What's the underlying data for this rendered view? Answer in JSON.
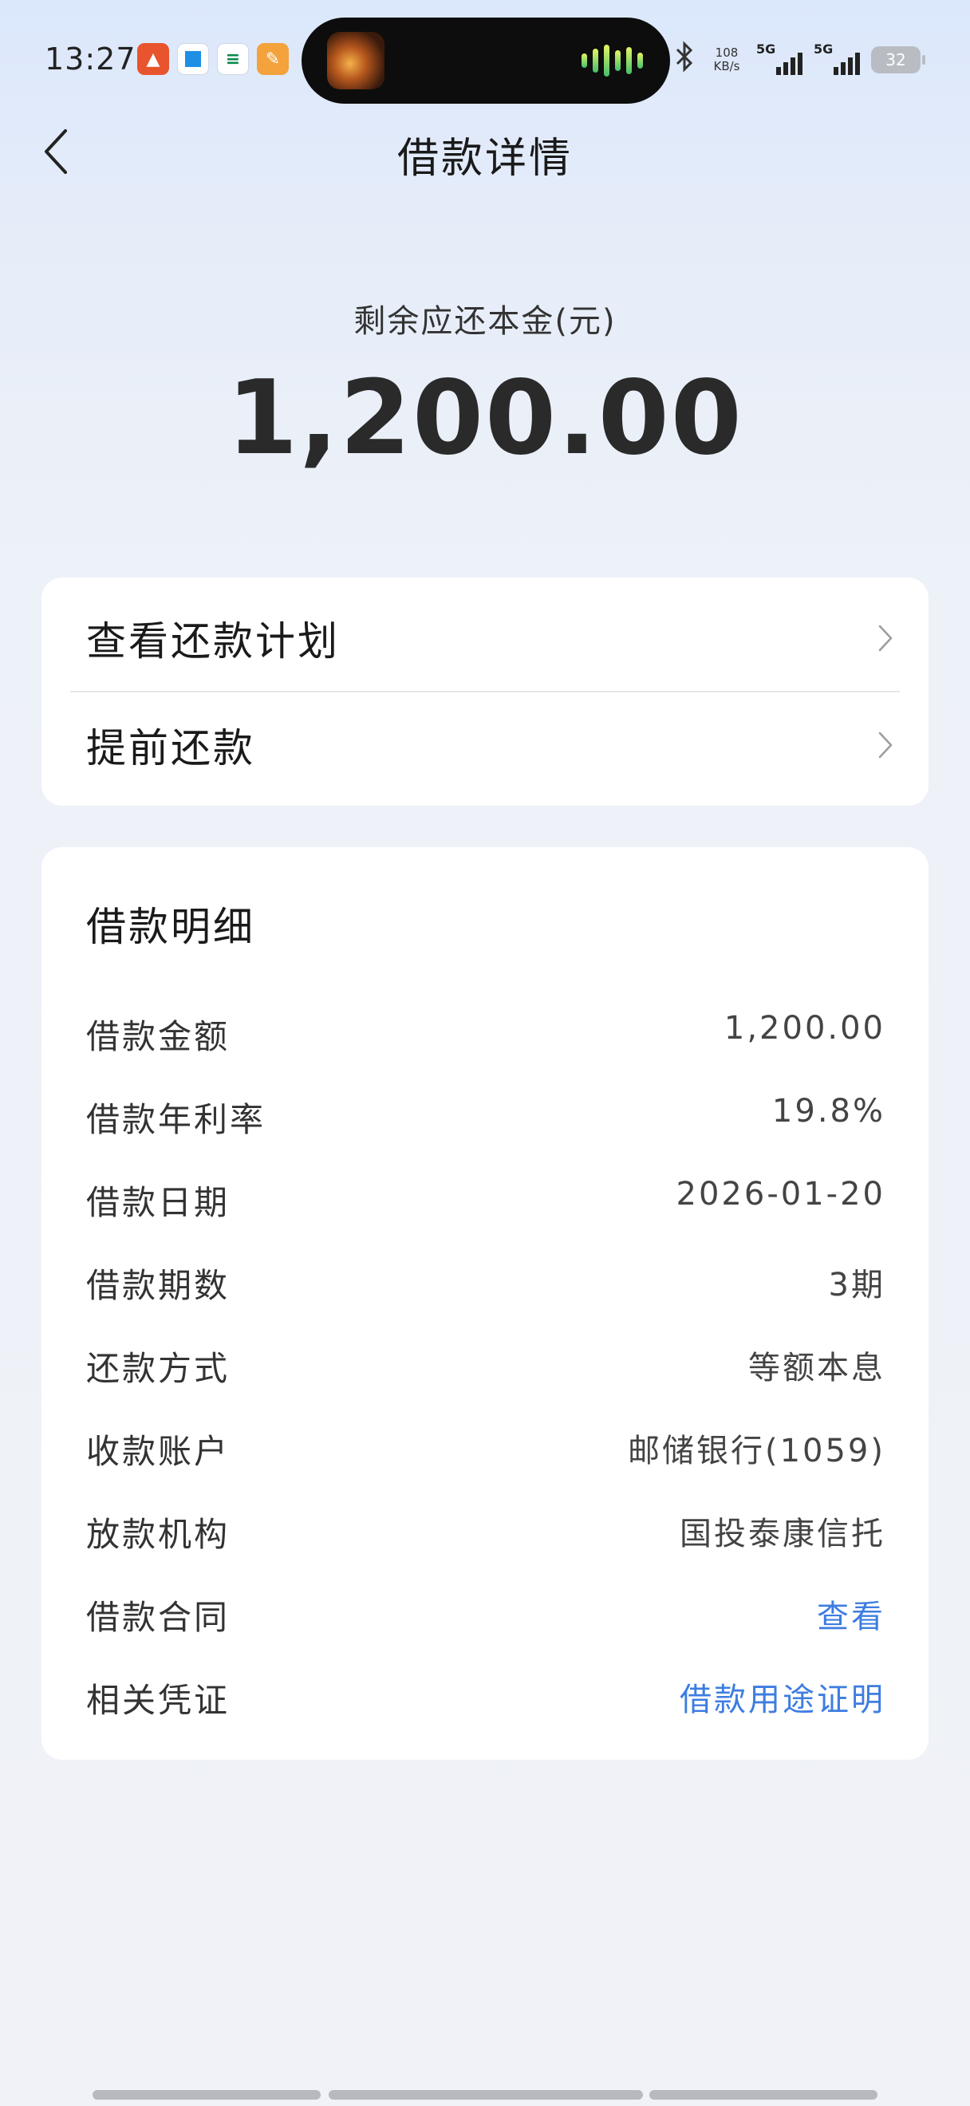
{
  "status_bar": {
    "time": "13:27",
    "net_speed": "108",
    "net_speed_unit": "KB/s",
    "signal_1": "5G",
    "signal_2": "5G",
    "battery": "32",
    "notification_icons": [
      "app-icon-red",
      "app-icon-blue",
      "app-icon-green",
      "app-icon-orange"
    ]
  },
  "header": {
    "title": "借款详情",
    "back_icon": "chevron-left-icon"
  },
  "summary": {
    "label": "剩余应还本金(元)",
    "amount": "1,200.00"
  },
  "actions": [
    {
      "label": "查看还款计划",
      "icon": "chevron-right-icon"
    },
    {
      "label": "提前还款",
      "icon": "chevron-right-icon"
    }
  ],
  "details": {
    "title": "借款明细",
    "rows": [
      {
        "key": "借款金额",
        "value": "1,200.00"
      },
      {
        "key": "借款年利率",
        "value": "19.8%"
      },
      {
        "key": "借款日期",
        "value": "2026-01-20"
      },
      {
        "key": "借款期数",
        "value": "3期"
      },
      {
        "key": "还款方式",
        "value": "等额本息"
      },
      {
        "key": "收款账户",
        "value": "邮储银行(1059)"
      },
      {
        "key": "放款机构",
        "value": "国投泰康信托"
      },
      {
        "key": "借款合同",
        "value": "查看"
      },
      {
        "key": "相关凭证",
        "value": "借款用途证明"
      }
    ]
  },
  "colors": {
    "link": "#3d7de0",
    "background_top": "#dbe7fb",
    "background_bottom": "#f0f2f7",
    "card": "#ffffff"
  }
}
